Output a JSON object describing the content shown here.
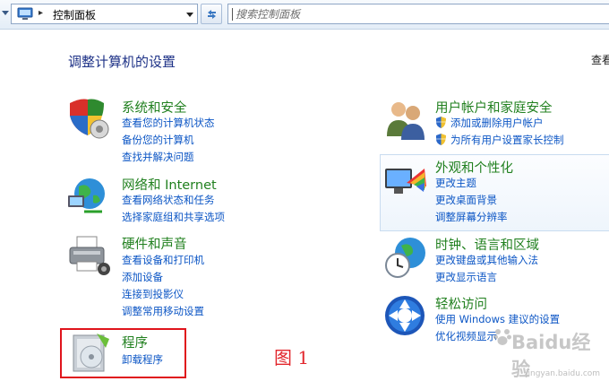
{
  "address": {
    "crumb": "控制面板",
    "separator": "▸"
  },
  "search": {
    "placeholder": "搜索控制面板"
  },
  "page": {
    "title": "调整计算机的设置",
    "view_by": "查看"
  },
  "categories": {
    "security": {
      "title": "系统和安全",
      "icon": "security-shield-icon",
      "links": [
        "查看您的计算机状态",
        "备份您的计算机",
        "查找并解决问题"
      ]
    },
    "network": {
      "title": "网络和 Internet",
      "icon": "network-globe-icon",
      "links": [
        "查看网络状态和任务",
        "选择家庭组和共享选项"
      ]
    },
    "hardware": {
      "title": "硬件和声音",
      "icon": "printer-icon",
      "links": [
        "查看设备和打印机",
        "添加设备",
        "连接到投影仪",
        "调整常用移动设置"
      ]
    },
    "programs": {
      "title": "程序",
      "icon": "programs-icon",
      "links": [
        "卸载程序"
      ]
    },
    "users": {
      "title": "用户帐户和家庭安全",
      "icon": "users-icon",
      "links": [
        "添加或删除用户帐户",
        "为所有用户设置家长控制"
      ]
    },
    "appearance": {
      "title": "外观和个性化",
      "icon": "display-palette-icon",
      "links": [
        "更改主题",
        "更改桌面背景",
        "调整屏幕分辨率"
      ]
    },
    "clock": {
      "title": "时钟、语言和区域",
      "icon": "clock-globe-icon",
      "links": [
        "更改键盘或其他输入法",
        "更改显示语言"
      ]
    },
    "access": {
      "title": "轻松访问",
      "icon": "ease-of-access-icon",
      "links": [
        "使用 Windows 建议的设置",
        "优化视频显示"
      ]
    }
  },
  "annotation": {
    "figure_label": "图 1"
  },
  "watermark": {
    "brand": "Baidu经验",
    "url": "jingyan.baidu.com"
  },
  "colors": {
    "category_title": "#21801f",
    "link": "#0c56c5",
    "page_title": "#1e3287",
    "highlight_box": "#e0141c"
  }
}
